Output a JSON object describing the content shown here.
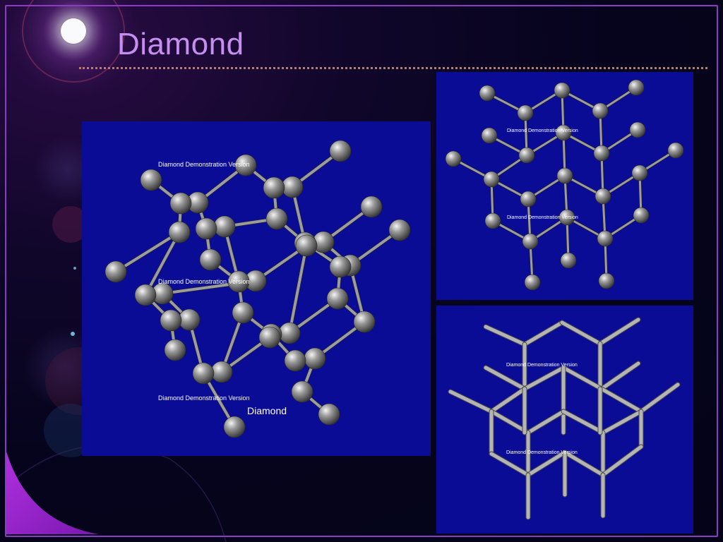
{
  "slide": {
    "title": "Diamond"
  },
  "panels": {
    "main": {
      "watermark": "Diamond Demonstration Version",
      "label": "Diamond"
    },
    "top": {
      "watermark": "Diamond Demonstration Version"
    },
    "bottom": {
      "watermark": "Diamond Demonstration Version"
    }
  },
  "colors": {
    "title": "#c58ef0",
    "panel_bg": "#0a0c96",
    "frame": "#8a3cc0",
    "rule": "#c87858"
  }
}
